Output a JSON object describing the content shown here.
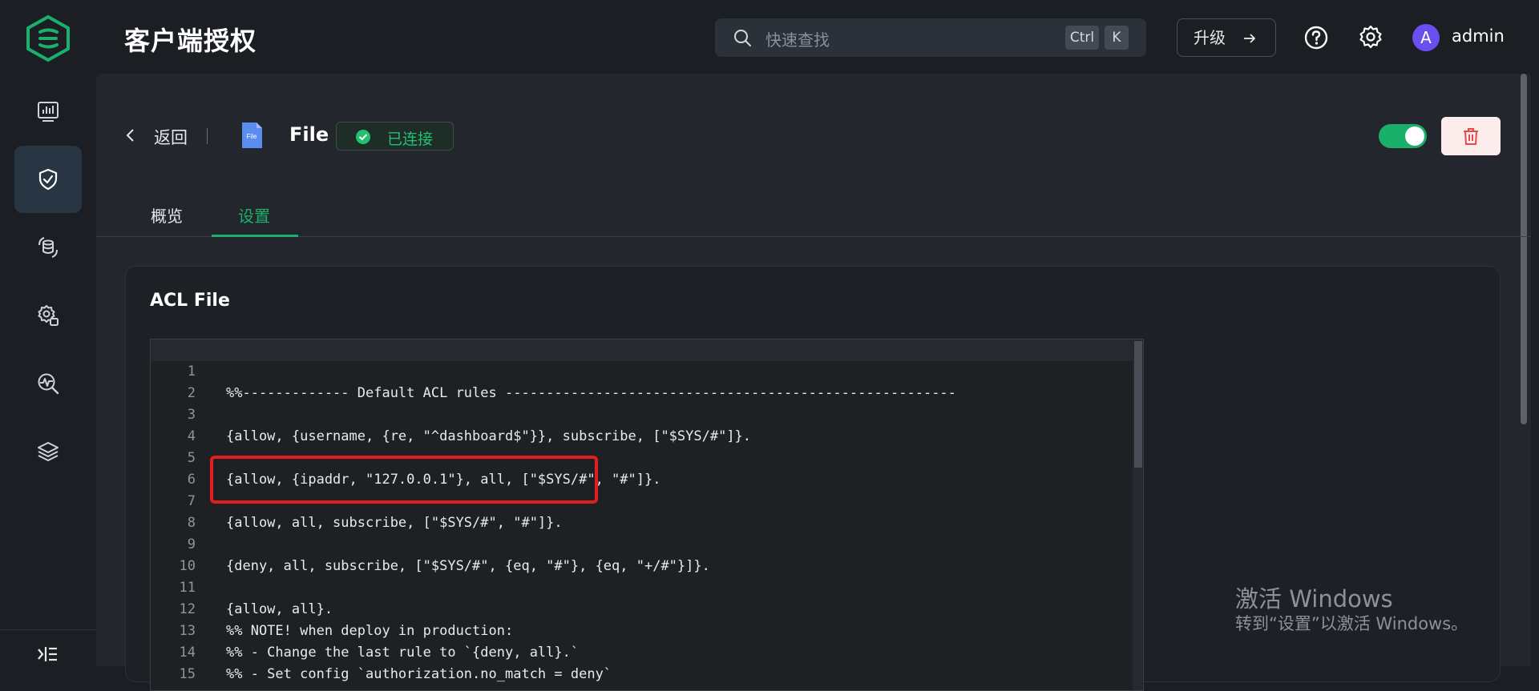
{
  "header": {
    "page_title": "客户端授权",
    "search": {
      "placeholder": "快速查找",
      "shortcut_ctrl": "Ctrl",
      "shortcut_key": "K"
    },
    "upgrade_label": "升级",
    "avatar_letter": "A",
    "username": "admin"
  },
  "sidebar": {
    "items": [
      {
        "icon": "dashboard-icon",
        "active": false
      },
      {
        "icon": "shield-check-icon",
        "active": true
      },
      {
        "icon": "data-integration-icon",
        "active": false
      },
      {
        "icon": "management-gear-icon",
        "active": false
      },
      {
        "icon": "monitoring-icon",
        "active": false
      },
      {
        "icon": "layers-icon",
        "active": false
      }
    ]
  },
  "detail": {
    "back_label": "返回",
    "file_icon_text": "File",
    "name": "File",
    "status": "已连接",
    "enabled": true,
    "tabs": [
      {
        "label": "概览",
        "active": false
      },
      {
        "label": "设置",
        "active": true
      }
    ]
  },
  "card": {
    "title": "ACL File",
    "lines": [
      {
        "n": "1",
        "text": "%%------------- Default ACL rules -------------------------------------------------------"
      },
      {
        "n": "2",
        "text": ""
      },
      {
        "n": "3",
        "text": "{allow, {username, {re, \"^dashboard$\"}}, subscribe, [\"$SYS/#\"]}."
      },
      {
        "n": "4",
        "text": ""
      },
      {
        "n": "5",
        "text": "{allow, {ipaddr, \"127.0.0.1\"}, all, [\"$SYS/#\", \"#\"]}."
      },
      {
        "n": "6",
        "text": ""
      },
      {
        "n": "7",
        "text": "{allow, all, subscribe, [\"$SYS/#\", \"#\"]}."
      },
      {
        "n": "8",
        "text": ""
      },
      {
        "n": "9",
        "text": "{deny, all, subscribe, [\"$SYS/#\", {eq, \"#\"}, {eq, \"+/#\"}]}."
      },
      {
        "n": "10",
        "text": ""
      },
      {
        "n": "11",
        "text": "{allow, all}."
      },
      {
        "n": "12",
        "text": "%% NOTE! when deploy in production:"
      },
      {
        "n": "13",
        "text": "%% - Change the last rule to `{deny, all}.`"
      },
      {
        "n": "14",
        "text": "%% - Set config `authorization.no_match = deny`"
      },
      {
        "n": "15",
        "text": ""
      }
    ]
  },
  "watermark": {
    "title": "激活 Windows",
    "subtitle": "转到“设置”以激活 Windows。"
  },
  "colors": {
    "accent": "#1cb16a",
    "danger": "#e0201e",
    "avatar": "#6a4ff0"
  }
}
